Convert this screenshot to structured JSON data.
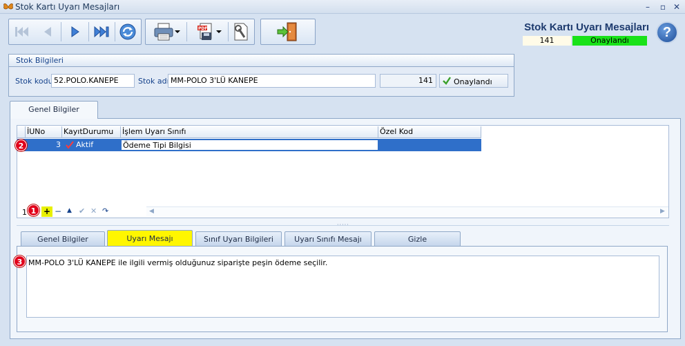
{
  "window": {
    "title": "Stok Kartı Uyarı Mesajları"
  },
  "header": {
    "title": "Stok Kartı Uyarı Mesajları",
    "number": "141",
    "status": "Onaylandı",
    "help_label": "?"
  },
  "stock_group": {
    "title": "Stok Bilgileri",
    "code_label": "Stok kodu",
    "code_value": "52.POLO.KANEPE",
    "name_label": "Stok adı",
    "name_value": "MM-POLO 3'LÜ KANEPE",
    "number_value": "141",
    "status_value": "Onaylandı"
  },
  "top_tabs": [
    {
      "label": "Genel Bilgiler"
    }
  ],
  "grid": {
    "columns": [
      "İUNo",
      "KayıtDurumu",
      "İşlem Uyarı Sınıfı",
      "Özel Kod"
    ],
    "rows": [
      {
        "no": "3",
        "status": "Aktif",
        "class": "Ödeme Tipi Bilgisi",
        "code": ""
      }
    ],
    "nav_prefix": "1"
  },
  "bottom_tabs": [
    {
      "label": "Genel Bilgiler"
    },
    {
      "label": "Uyarı Mesajı"
    },
    {
      "label": "Sınıf Uyarı Bilgileri"
    },
    {
      "label": "Uyarı Sınıfı Mesajı"
    },
    {
      "label": "Gizle"
    }
  ],
  "message": {
    "text": "MM-POLO 3'LÜ KANEPE ile ilgili vermiş olduğunuz siparişte peşin ödeme seçilir."
  },
  "badges": [
    "1",
    "2",
    "3"
  ],
  "colors": {
    "accent": "#1d3a6e",
    "status_green": "#19e219",
    "selected_row": "#2f6fc9",
    "active_tab": "#fff600",
    "badge_red": "#e1001a"
  }
}
